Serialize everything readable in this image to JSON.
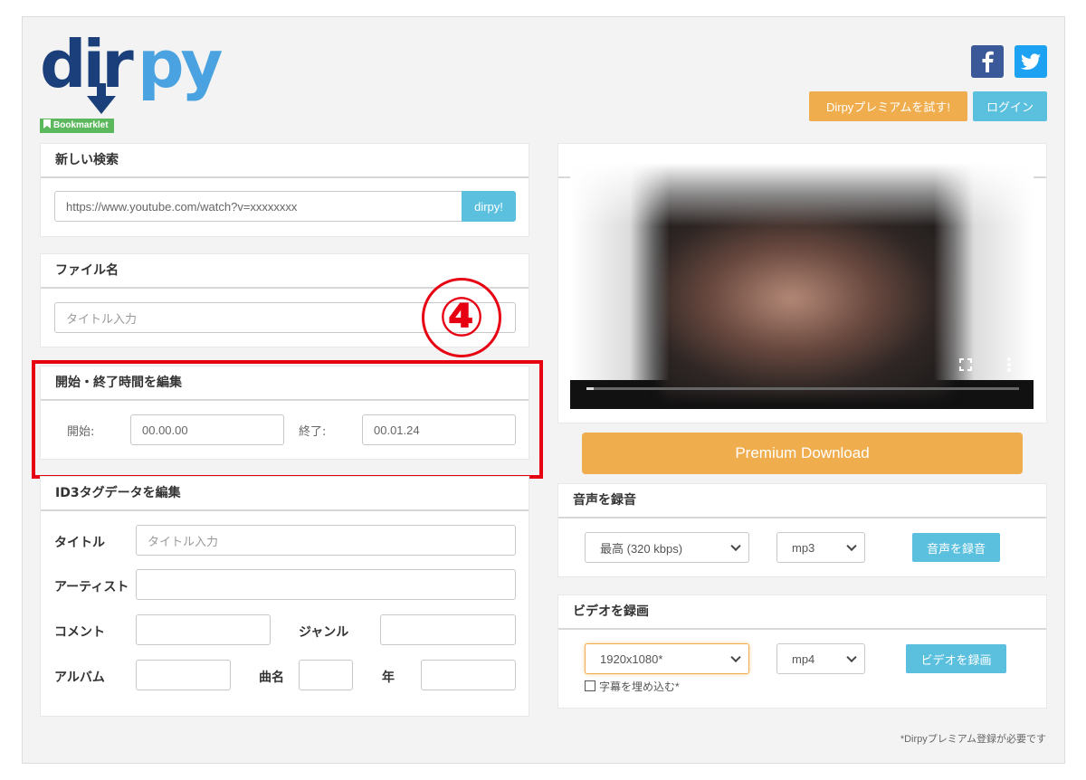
{
  "logo": {
    "text_dark": "dir",
    "text_light": "py",
    "bookmarklet": "Bookmarklet"
  },
  "header": {
    "premium_button": "Dirpyプレミアムを試す!",
    "login_button": "ログイン"
  },
  "search": {
    "title": "新しい検索",
    "url_value": "https://www.youtube.com/watch?v=xxxxxxxx",
    "submit_label": "dirpy!"
  },
  "filename": {
    "title": "ファイル名",
    "placeholder": "タイトル入力"
  },
  "trim": {
    "title": "開始・終了時間を編集",
    "start_label": "開始:",
    "start_value": "00.00.00",
    "end_label": "終了:",
    "end_value": "00.01.24"
  },
  "annotation": {
    "number": "④"
  },
  "id3": {
    "title": "ID3タグデータを編集",
    "title_label": "タイトル",
    "title_placeholder": "タイトル入力",
    "artist_label": "アーティスト",
    "comment_label": "コメント",
    "genre_label": "ジャンル",
    "album_label": "アルバム",
    "track_label": "曲名",
    "year_label": "年"
  },
  "premium_download": "Premium Download",
  "audio": {
    "title": "音声を録音",
    "quality": "最高 (320 kbps)",
    "format": "mp3",
    "button": "音声を録音"
  },
  "video": {
    "title": "ビデオを録画",
    "resolution": "1920x1080*",
    "format": "mp4",
    "button": "ビデオを録画",
    "subtitle_checkbox": "字幕を埋め込む*"
  },
  "footnote": "*Dirpyプレミアム登録が必要です",
  "colors": {
    "orange": "#f0ad4e",
    "blue": "#5bc0de",
    "red": "#e60012",
    "facebook": "#3b5998",
    "twitter": "#1da1f2"
  }
}
